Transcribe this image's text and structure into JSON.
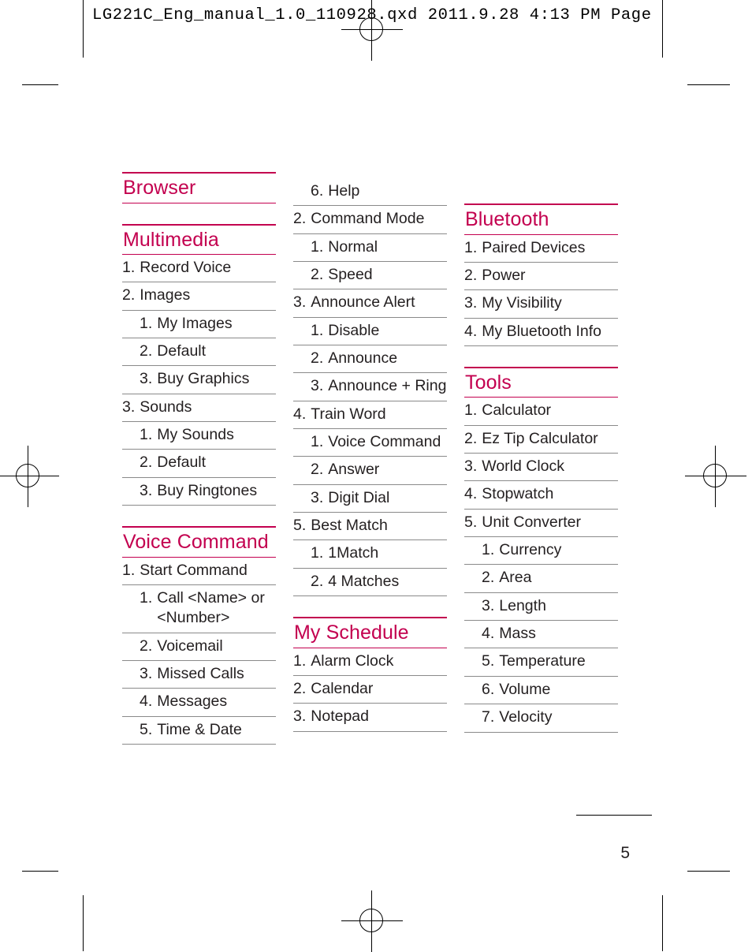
{
  "proof_header": "LG221C_Eng_manual_1.0_110928.qxd   2011.9.28   4:13  PM   Page",
  "page_number": "5",
  "accent_color": "#c3004f",
  "rule_color": "#8a8a8a",
  "columns": [
    {
      "id": "column-1",
      "sections": [
        {
          "heading": "Browser",
          "items": []
        },
        {
          "heading": "Multimedia",
          "items": [
            {
              "level": 1,
              "num": "1.",
              "text": "Record Voice"
            },
            {
              "level": 1,
              "num": "2.",
              "text": "Images"
            },
            {
              "level": 2,
              "num": "1.",
              "text": "My Images"
            },
            {
              "level": 2,
              "num": "2.",
              "text": "Default"
            },
            {
              "level": 2,
              "num": "3.",
              "text": "Buy Graphics"
            },
            {
              "level": 1,
              "num": "3.",
              "text": "Sounds"
            },
            {
              "level": 2,
              "num": "1.",
              "text": "My Sounds"
            },
            {
              "level": 2,
              "num": "2.",
              "text": "Default"
            },
            {
              "level": 2,
              "num": "3.",
              "text": "Buy Ringtones"
            }
          ]
        },
        {
          "heading": "Voice Command",
          "items": [
            {
              "level": 1,
              "num": "1.",
              "text": "Start Command"
            },
            {
              "level": 2,
              "num": "1.",
              "text": "Call <Name> or <Number>"
            },
            {
              "level": 2,
              "num": "2.",
              "text": "Voicemail"
            },
            {
              "level": 2,
              "num": "3.",
              "text": "Missed Calls"
            },
            {
              "level": 2,
              "num": "4.",
              "text": "Messages"
            },
            {
              "level": 2,
              "num": "5.",
              "text": "Time & Date"
            }
          ]
        }
      ]
    },
    {
      "id": "column-2",
      "sections": [
        {
          "heading": null,
          "items": [
            {
              "level": 2,
              "num": "6.",
              "text": "Help"
            },
            {
              "level": 1,
              "num": "2.",
              "text": "Command Mode"
            },
            {
              "level": 2,
              "num": "1.",
              "text": "Normal"
            },
            {
              "level": 2,
              "num": "2.",
              "text": "Speed"
            },
            {
              "level": 1,
              "num": "3.",
              "text": "Announce Alert"
            },
            {
              "level": 2,
              "num": "1.",
              "text": "Disable"
            },
            {
              "level": 2,
              "num": "2.",
              "text": "Announce"
            },
            {
              "level": 2,
              "num": "3.",
              "text": "Announce + Ring"
            },
            {
              "level": 1,
              "num": "4.",
              "text": "Train Word"
            },
            {
              "level": 2,
              "num": "1.",
              "text": "Voice Command"
            },
            {
              "level": 2,
              "num": "2.",
              "text": "Answer"
            },
            {
              "level": 2,
              "num": "3.",
              "text": "Digit Dial"
            },
            {
              "level": 1,
              "num": "5.",
              "text": "Best Match"
            },
            {
              "level": 2,
              "num": "1.",
              "text": "1Match"
            },
            {
              "level": 2,
              "num": "2.",
              "text": "4 Matches"
            }
          ]
        },
        {
          "heading": "My Schedule",
          "items": [
            {
              "level": 1,
              "num": "1.",
              "text": "Alarm Clock"
            },
            {
              "level": 1,
              "num": "2.",
              "text": "Calendar"
            },
            {
              "level": 1,
              "num": "3.",
              "text": "Notepad"
            }
          ]
        }
      ]
    },
    {
      "id": "column-3",
      "sections": [
        {
          "heading": "Bluetooth",
          "items": [
            {
              "level": 1,
              "num": "1.",
              "text": "Paired Devices"
            },
            {
              "level": 1,
              "num": "2.",
              "text": "Power"
            },
            {
              "level": 1,
              "num": "3.",
              "text": "My Visibility"
            },
            {
              "level": 1,
              "num": "4.",
              "text": "My Bluetooth Info"
            }
          ]
        },
        {
          "heading": "Tools",
          "items": [
            {
              "level": 1,
              "num": "1.",
              "text": "Calculator"
            },
            {
              "level": 1,
              "num": "2.",
              "text": "Ez Tip Calculator"
            },
            {
              "level": 1,
              "num": "3.",
              "text": "World Clock"
            },
            {
              "level": 1,
              "num": "4.",
              "text": "Stopwatch"
            },
            {
              "level": 1,
              "num": "5.",
              "text": "Unit Converter"
            },
            {
              "level": 2,
              "num": "1.",
              "text": "Currency"
            },
            {
              "level": 2,
              "num": "2.",
              "text": "Area"
            },
            {
              "level": 2,
              "num": "3.",
              "text": "Length"
            },
            {
              "level": 2,
              "num": "4.",
              "text": "Mass"
            },
            {
              "level": 2,
              "num": "5.",
              "text": "Temperature"
            },
            {
              "level": 2,
              "num": "6.",
              "text": "Volume"
            },
            {
              "level": 2,
              "num": "7.",
              "text": "Velocity"
            }
          ]
        }
      ]
    }
  ]
}
